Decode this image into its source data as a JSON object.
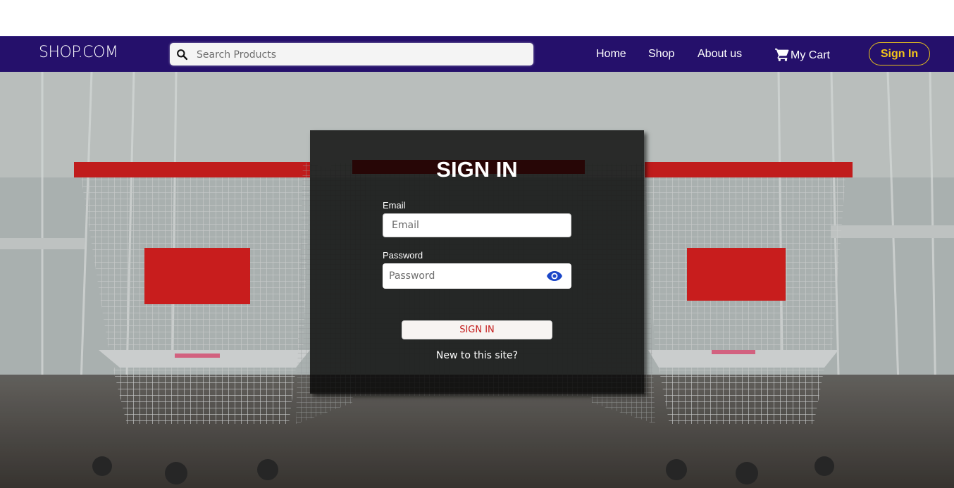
{
  "header": {
    "logo_text": "SHOP.COM",
    "search": {
      "placeholder": "Search Products",
      "value": ""
    },
    "nav": {
      "home": "Home",
      "shop": "Shop",
      "about": "About us",
      "cart": "My Cart"
    },
    "signin_button": "Sign In"
  },
  "signin_form": {
    "title": "SIGN IN",
    "email_label": "Email",
    "email_placeholder": "Email",
    "password_label": "Password",
    "password_placeholder": "Password",
    "submit_label": "SIGN IN",
    "new_user_text": "New to this site?"
  },
  "icons": {
    "search": "search-icon",
    "cart": "cart-icon",
    "show_password": "eye-icon"
  },
  "colors": {
    "navbar": "#25106b",
    "signin_accent": "#f3c51a",
    "submit_text": "#c41d1d",
    "eye_icon": "#1b47c8"
  }
}
